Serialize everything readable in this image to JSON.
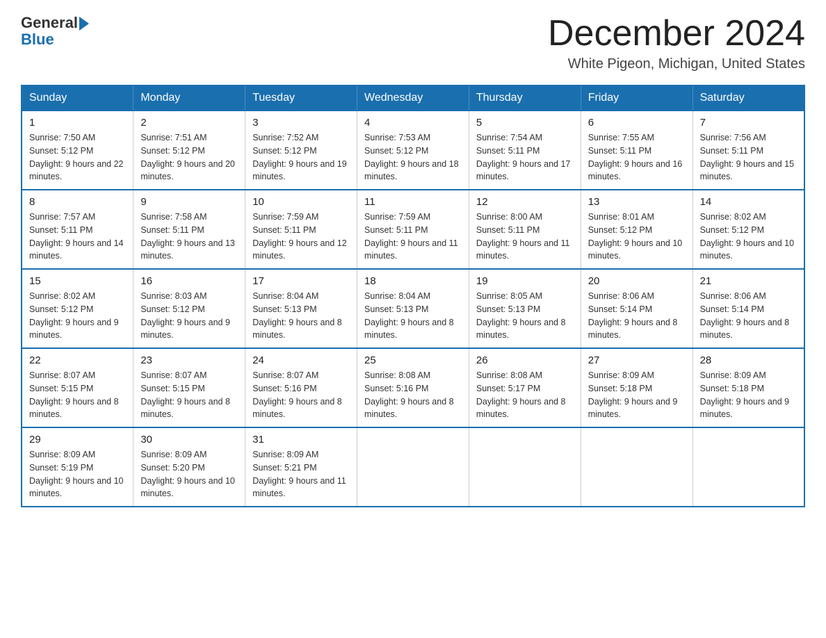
{
  "logo": {
    "general": "General",
    "blue": "Blue"
  },
  "title": "December 2024",
  "location": "White Pigeon, Michigan, United States",
  "weekdays": [
    "Sunday",
    "Monday",
    "Tuesday",
    "Wednesday",
    "Thursday",
    "Friday",
    "Saturday"
  ],
  "weeks": [
    [
      {
        "day": "1",
        "sunrise": "7:50 AM",
        "sunset": "5:12 PM",
        "daylight": "9 hours and 22 minutes."
      },
      {
        "day": "2",
        "sunrise": "7:51 AM",
        "sunset": "5:12 PM",
        "daylight": "9 hours and 20 minutes."
      },
      {
        "day": "3",
        "sunrise": "7:52 AM",
        "sunset": "5:12 PM",
        "daylight": "9 hours and 19 minutes."
      },
      {
        "day": "4",
        "sunrise": "7:53 AM",
        "sunset": "5:12 PM",
        "daylight": "9 hours and 18 minutes."
      },
      {
        "day": "5",
        "sunrise": "7:54 AM",
        "sunset": "5:11 PM",
        "daylight": "9 hours and 17 minutes."
      },
      {
        "day": "6",
        "sunrise": "7:55 AM",
        "sunset": "5:11 PM",
        "daylight": "9 hours and 16 minutes."
      },
      {
        "day": "7",
        "sunrise": "7:56 AM",
        "sunset": "5:11 PM",
        "daylight": "9 hours and 15 minutes."
      }
    ],
    [
      {
        "day": "8",
        "sunrise": "7:57 AM",
        "sunset": "5:11 PM",
        "daylight": "9 hours and 14 minutes."
      },
      {
        "day": "9",
        "sunrise": "7:58 AM",
        "sunset": "5:11 PM",
        "daylight": "9 hours and 13 minutes."
      },
      {
        "day": "10",
        "sunrise": "7:59 AM",
        "sunset": "5:11 PM",
        "daylight": "9 hours and 12 minutes."
      },
      {
        "day": "11",
        "sunrise": "7:59 AM",
        "sunset": "5:11 PM",
        "daylight": "9 hours and 11 minutes."
      },
      {
        "day": "12",
        "sunrise": "8:00 AM",
        "sunset": "5:11 PM",
        "daylight": "9 hours and 11 minutes."
      },
      {
        "day": "13",
        "sunrise": "8:01 AM",
        "sunset": "5:12 PM",
        "daylight": "9 hours and 10 minutes."
      },
      {
        "day": "14",
        "sunrise": "8:02 AM",
        "sunset": "5:12 PM",
        "daylight": "9 hours and 10 minutes."
      }
    ],
    [
      {
        "day": "15",
        "sunrise": "8:02 AM",
        "sunset": "5:12 PM",
        "daylight": "9 hours and 9 minutes."
      },
      {
        "day": "16",
        "sunrise": "8:03 AM",
        "sunset": "5:12 PM",
        "daylight": "9 hours and 9 minutes."
      },
      {
        "day": "17",
        "sunrise": "8:04 AM",
        "sunset": "5:13 PM",
        "daylight": "9 hours and 8 minutes."
      },
      {
        "day": "18",
        "sunrise": "8:04 AM",
        "sunset": "5:13 PM",
        "daylight": "9 hours and 8 minutes."
      },
      {
        "day": "19",
        "sunrise": "8:05 AM",
        "sunset": "5:13 PM",
        "daylight": "9 hours and 8 minutes."
      },
      {
        "day": "20",
        "sunrise": "8:06 AM",
        "sunset": "5:14 PM",
        "daylight": "9 hours and 8 minutes."
      },
      {
        "day": "21",
        "sunrise": "8:06 AM",
        "sunset": "5:14 PM",
        "daylight": "9 hours and 8 minutes."
      }
    ],
    [
      {
        "day": "22",
        "sunrise": "8:07 AM",
        "sunset": "5:15 PM",
        "daylight": "9 hours and 8 minutes."
      },
      {
        "day": "23",
        "sunrise": "8:07 AM",
        "sunset": "5:15 PM",
        "daylight": "9 hours and 8 minutes."
      },
      {
        "day": "24",
        "sunrise": "8:07 AM",
        "sunset": "5:16 PM",
        "daylight": "9 hours and 8 minutes."
      },
      {
        "day": "25",
        "sunrise": "8:08 AM",
        "sunset": "5:16 PM",
        "daylight": "9 hours and 8 minutes."
      },
      {
        "day": "26",
        "sunrise": "8:08 AM",
        "sunset": "5:17 PM",
        "daylight": "9 hours and 8 minutes."
      },
      {
        "day": "27",
        "sunrise": "8:09 AM",
        "sunset": "5:18 PM",
        "daylight": "9 hours and 9 minutes."
      },
      {
        "day": "28",
        "sunrise": "8:09 AM",
        "sunset": "5:18 PM",
        "daylight": "9 hours and 9 minutes."
      }
    ],
    [
      {
        "day": "29",
        "sunrise": "8:09 AM",
        "sunset": "5:19 PM",
        "daylight": "9 hours and 10 minutes."
      },
      {
        "day": "30",
        "sunrise": "8:09 AM",
        "sunset": "5:20 PM",
        "daylight": "9 hours and 10 minutes."
      },
      {
        "day": "31",
        "sunrise": "8:09 AM",
        "sunset": "5:21 PM",
        "daylight": "9 hours and 11 minutes."
      },
      null,
      null,
      null,
      null
    ]
  ]
}
